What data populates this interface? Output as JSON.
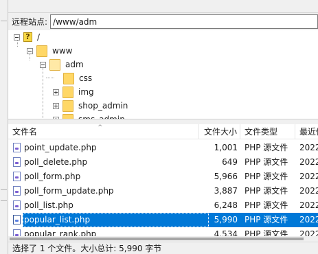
{
  "address": {
    "label": "远程站点:",
    "path": "/www/adm"
  },
  "tree": {
    "nodes": [
      {
        "label": "/"
      },
      {
        "label": "www"
      },
      {
        "label": "adm"
      },
      {
        "label": "css"
      },
      {
        "label": "img"
      },
      {
        "label": "shop_admin"
      },
      {
        "label": "sms_admin"
      }
    ]
  },
  "filelist": {
    "columns": {
      "name": "文件名",
      "size": "文件大小",
      "type": "文件类型",
      "modified": "最近修"
    },
    "rows": [
      {
        "name": "point_update.php",
        "size": "1,001",
        "type": "PHP 源文件",
        "modified": "2022"
      },
      {
        "name": "poll_delete.php",
        "size": "649",
        "type": "PHP 源文件",
        "modified": "2022"
      },
      {
        "name": "poll_form.php",
        "size": "5,966",
        "type": "PHP 源文件",
        "modified": "2022"
      },
      {
        "name": "poll_form_update.php",
        "size": "3,887",
        "type": "PHP 源文件",
        "modified": "2022"
      },
      {
        "name": "poll_list.php",
        "size": "6,248",
        "type": "PHP 源文件",
        "modified": "2022"
      },
      {
        "name": "popular_list.php",
        "size": "5,990",
        "type": "PHP 源文件",
        "modified": "2022"
      },
      {
        "name": "popular_rank.php",
        "size": "4,534",
        "type": "PHP 源文件",
        "modified": "2022"
      }
    ],
    "selected_row": 5
  },
  "status": {
    "text": "选择了 1 个文件。大小总计: 5,990 字节"
  },
  "colors": {
    "selection": "#0078d7",
    "folder": "#ffd766"
  }
}
